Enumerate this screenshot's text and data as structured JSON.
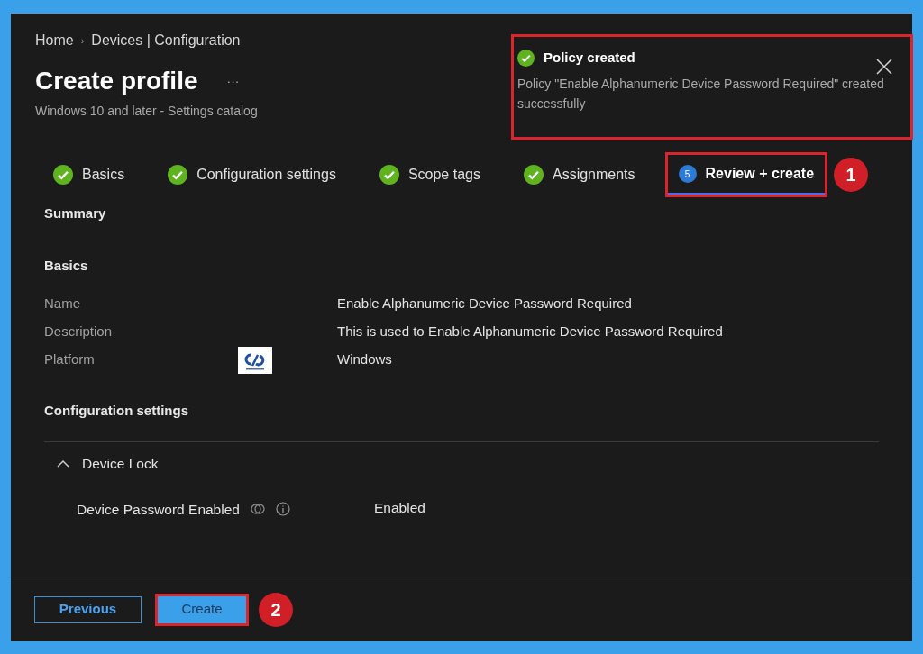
{
  "breadcrumb": [
    "Home",
    "Devices | Configuration"
  ],
  "breadcrumb_separator": "›",
  "page": {
    "title": "Create profile",
    "more": "···",
    "subtitle": "Windows 10 and later - Settings catalog"
  },
  "toast": {
    "title": "Policy created",
    "message": "Policy \"Enable Alphanumeric Device Password Required\" created successfully",
    "highlighted": true
  },
  "tabs": [
    {
      "label": "Basics",
      "completed": true,
      "selected": false,
      "highlighted": false
    },
    {
      "label": "Configuration settings",
      "completed": true,
      "selected": false,
      "highlighted": false
    },
    {
      "label": "Scope tags",
      "completed": true,
      "selected": false,
      "highlighted": false
    },
    {
      "label": "Assignments",
      "completed": true,
      "selected": false,
      "highlighted": false
    },
    {
      "label": "Review + create",
      "completed": false,
      "step": "5",
      "selected": true,
      "highlighted": true,
      "callout": "1"
    }
  ],
  "summary": {
    "heading": "Summary",
    "basics_heading": "Basics",
    "fields": [
      {
        "label": "Name",
        "value": "Enable Alphanumeric Device Password Required"
      },
      {
        "label": "Description",
        "value": "This is used to Enable Alphanumeric Device Password Required"
      },
      {
        "label": "Platform",
        "value": "Windows",
        "logo": true
      }
    ],
    "config_heading": "Configuration settings",
    "group": {
      "title": "Device Lock",
      "expanded": true,
      "settings": [
        {
          "label": "Device Password Enabled",
          "value": "Enabled"
        }
      ]
    }
  },
  "footer": {
    "buttons": [
      {
        "label": "Previous",
        "kind": "secondary",
        "highlighted": false
      },
      {
        "label": "Create",
        "kind": "primary",
        "highlighted": true,
        "callout": "2"
      }
    ]
  }
}
